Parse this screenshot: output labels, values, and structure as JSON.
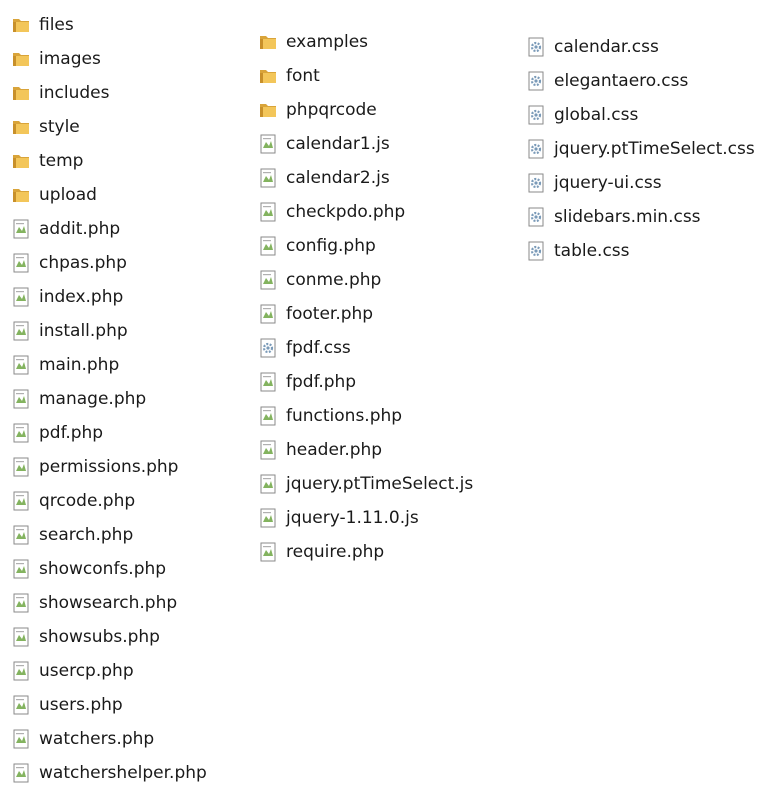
{
  "explorer": {
    "columns": [
      {
        "items": [
          {
            "name": "files",
            "type": "folder"
          },
          {
            "name": "images",
            "type": "folder"
          },
          {
            "name": "includes",
            "type": "folder"
          },
          {
            "name": "style",
            "type": "folder"
          },
          {
            "name": "temp",
            "type": "folder"
          },
          {
            "name": "upload",
            "type": "folder"
          },
          {
            "name": "addit.php",
            "type": "script"
          },
          {
            "name": "chpas.php",
            "type": "script"
          },
          {
            "name": "index.php",
            "type": "script"
          },
          {
            "name": "install.php",
            "type": "script"
          },
          {
            "name": "main.php",
            "type": "script"
          },
          {
            "name": "manage.php",
            "type": "script"
          },
          {
            "name": "pdf.php",
            "type": "script"
          },
          {
            "name": "permissions.php",
            "type": "script"
          },
          {
            "name": "qrcode.php",
            "type": "script"
          },
          {
            "name": "search.php",
            "type": "script"
          },
          {
            "name": "showconfs.php",
            "type": "script"
          },
          {
            "name": "showsearch.php",
            "type": "script"
          },
          {
            "name": "showsubs.php",
            "type": "script"
          },
          {
            "name": "usercp.php",
            "type": "script"
          },
          {
            "name": "users.php",
            "type": "script"
          },
          {
            "name": "watchers.php",
            "type": "script"
          },
          {
            "name": "watchershelper.php",
            "type": "script"
          }
        ]
      },
      {
        "items": [
          {
            "name": "examples",
            "type": "folder"
          },
          {
            "name": "font",
            "type": "folder"
          },
          {
            "name": "phpqrcode",
            "type": "folder"
          },
          {
            "name": "calendar1.js",
            "type": "script"
          },
          {
            "name": "calendar2.js",
            "type": "script"
          },
          {
            "name": "checkpdo.php",
            "type": "script"
          },
          {
            "name": "config.php",
            "type": "script"
          },
          {
            "name": "conme.php",
            "type": "script"
          },
          {
            "name": "footer.php",
            "type": "script"
          },
          {
            "name": "fpdf.css",
            "type": "css"
          },
          {
            "name": "fpdf.php",
            "type": "script"
          },
          {
            "name": "functions.php",
            "type": "script"
          },
          {
            "name": "header.php",
            "type": "script"
          },
          {
            "name": "jquery.ptTimeSelect.js",
            "type": "script"
          },
          {
            "name": "jquery-1.11.0.js",
            "type": "script"
          },
          {
            "name": "require.php",
            "type": "script"
          }
        ]
      },
      {
        "items": [
          {
            "name": "calendar.css",
            "type": "css"
          },
          {
            "name": "elegantaero.css",
            "type": "css"
          },
          {
            "name": "global.css",
            "type": "css"
          },
          {
            "name": "jquery.ptTimeSelect.css",
            "type": "css"
          },
          {
            "name": "jquery-ui.css",
            "type": "css"
          },
          {
            "name": "slidebars.min.css",
            "type": "css"
          },
          {
            "name": "table.css",
            "type": "css"
          }
        ]
      }
    ]
  },
  "icons": {
    "folder": "folder-icon",
    "script": "script-file-icon",
    "css": "css-file-icon"
  },
  "colors": {
    "folder_front": "#f3c65a",
    "folder_back": "#d9a43a",
    "file_border": "#8a8a8a",
    "script_glyph": "#5a9a2a",
    "css_gear": "#7a9ab8"
  }
}
